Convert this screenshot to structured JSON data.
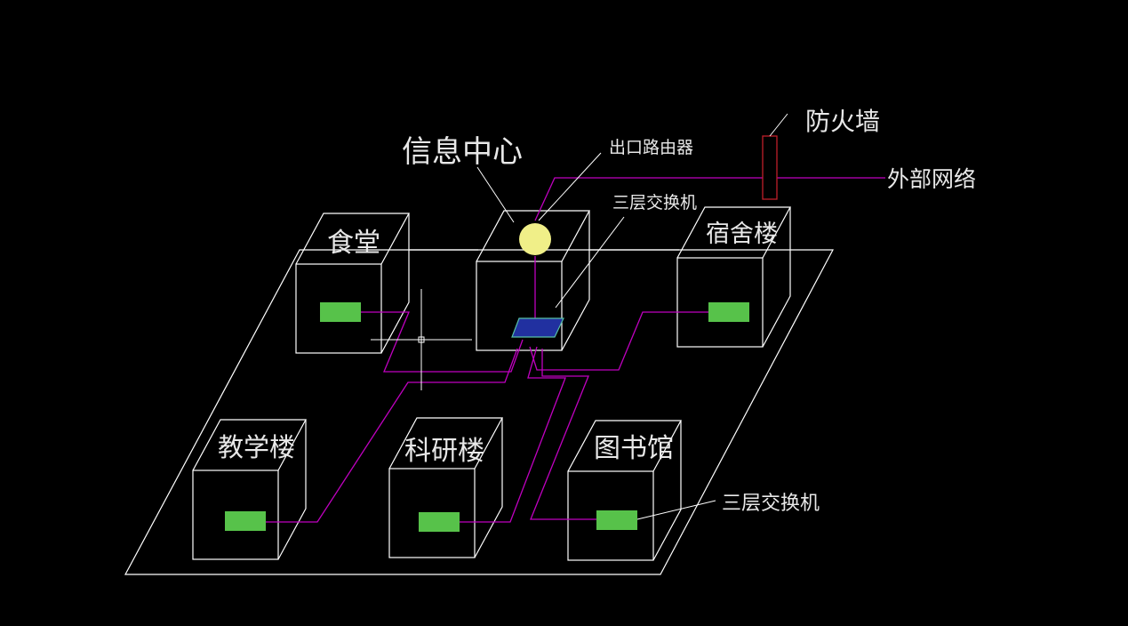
{
  "labels": {
    "info_center": "信息中心",
    "exit_router": "出口路由器",
    "l3_switch_top": "三层交换机",
    "firewall": "防火墙",
    "external_network": "外部网络",
    "canteen": "食堂",
    "dormitory": "宿舍楼",
    "teaching": "教学楼",
    "research": "科研楼",
    "library": "图书馆",
    "l3_switch_bottom": "三层交换机"
  },
  "colors": {
    "background": "#000000",
    "outline": "#ffffff",
    "link": "#c000c0",
    "switch_green": "#57c24a",
    "router_yellow": "#f0ef88",
    "core_switch_blue": "#2130a0",
    "firewall_red": "#c0202a"
  }
}
